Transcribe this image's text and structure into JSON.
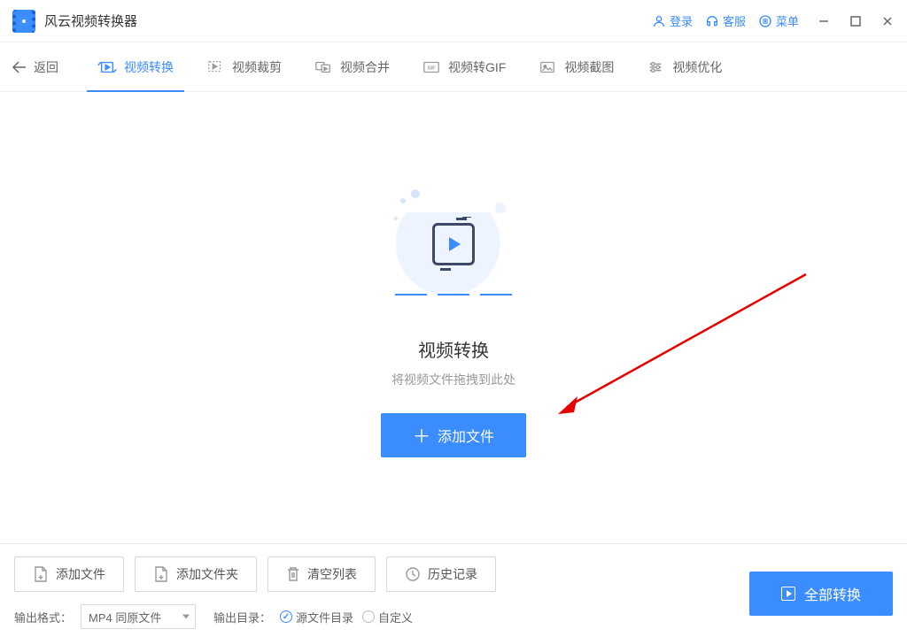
{
  "header": {
    "title": "风云视频转换器",
    "login": "登录",
    "support": "客服",
    "menu": "菜单"
  },
  "nav": {
    "back": "返回",
    "tabs": [
      {
        "label": "视频转换"
      },
      {
        "label": "视频裁剪"
      },
      {
        "label": "视频合并"
      },
      {
        "label": "视频转GIF"
      },
      {
        "label": "视频截图"
      },
      {
        "label": "视频优化"
      }
    ]
  },
  "empty": {
    "title": "视频转换",
    "subtitle": "将视频文件拖拽到此处",
    "add": "添加文件"
  },
  "footer": {
    "buttons": [
      "添加文件",
      "添加文件夹",
      "清空列表",
      "历史记录"
    ],
    "format_label": "输出格式：",
    "format_value": "MP4 同原文件",
    "dir_label": "输出目录：",
    "radio_source": "源文件目录",
    "radio_custom": "自定义",
    "convert_all": "全部转换"
  }
}
